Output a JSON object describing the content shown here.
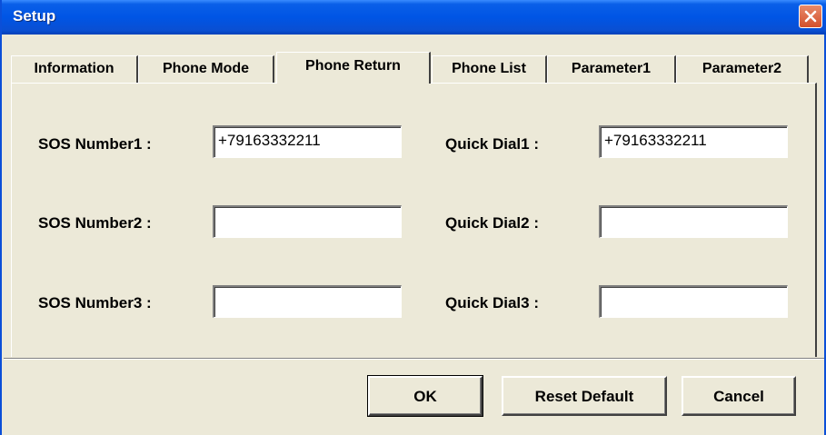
{
  "window": {
    "title": "Setup"
  },
  "tabs": [
    {
      "label": "Information"
    },
    {
      "label": "Phone Mode"
    },
    {
      "label": "Phone Return"
    },
    {
      "label": "Phone List"
    },
    {
      "label": "Parameter1"
    },
    {
      "label": "Parameter2"
    }
  ],
  "active_tab": "Phone Return",
  "sos": [
    {
      "label": "SOS Number1 :",
      "value": "+79163332211"
    },
    {
      "label": "SOS Number2 :",
      "value": ""
    },
    {
      "label": "SOS Number3 :",
      "value": ""
    }
  ],
  "quick": [
    {
      "label": "Quick Dial1 :",
      "value": "+79163332211"
    },
    {
      "label": "Quick Dial2 :",
      "value": ""
    },
    {
      "label": "Quick Dial3 :",
      "value": ""
    }
  ],
  "buttons": {
    "ok": "OK",
    "reset": "Reset Default",
    "cancel": "Cancel"
  },
  "colors": {
    "titlebar": "#0055e5",
    "face": "#ece9d8",
    "close": "#d4502c"
  }
}
